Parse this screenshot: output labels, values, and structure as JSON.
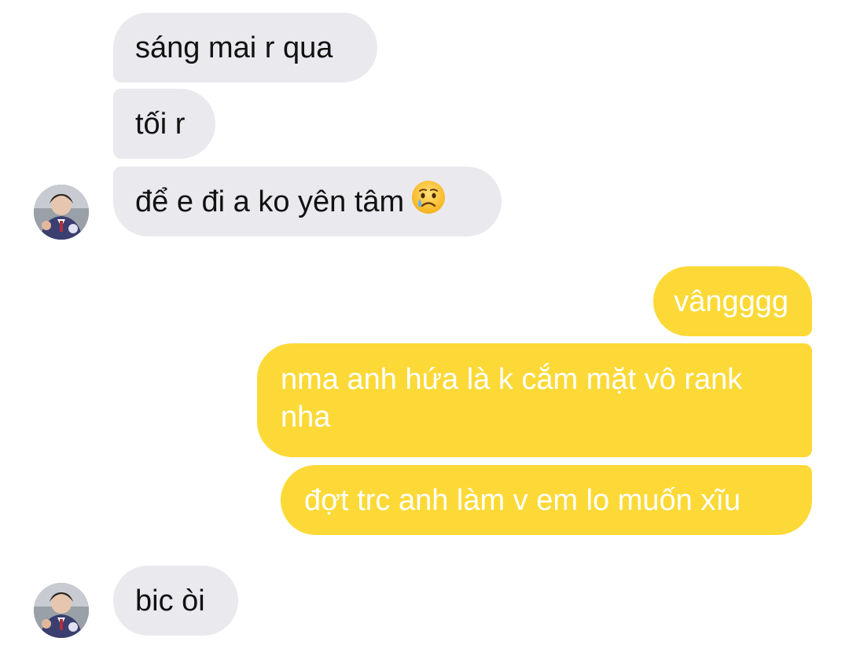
{
  "conversation": {
    "messages": [
      {
        "sender": "them",
        "text": "sáng mai r qua"
      },
      {
        "sender": "them",
        "text": "tối r"
      },
      {
        "sender": "them",
        "text": "để e đi a ko yên tâm",
        "emoji": "crying-face-icon"
      },
      {
        "sender": "me",
        "text": "vângggg"
      },
      {
        "sender": "me",
        "text": "nma anh hứa là k cắm mặt vô rank nha"
      },
      {
        "sender": "me",
        "text": "đợt trc anh làm v em lo muốn xĩu"
      },
      {
        "sender": "them",
        "text": "bic òi"
      }
    ]
  },
  "colors": {
    "incoming_bubble": "#e9e9ee",
    "outgoing_bubble": "#fcd936",
    "incoming_text": "#111111",
    "outgoing_text": "#ffffff"
  },
  "icons": [
    "avatar",
    "crying-face-icon"
  ]
}
